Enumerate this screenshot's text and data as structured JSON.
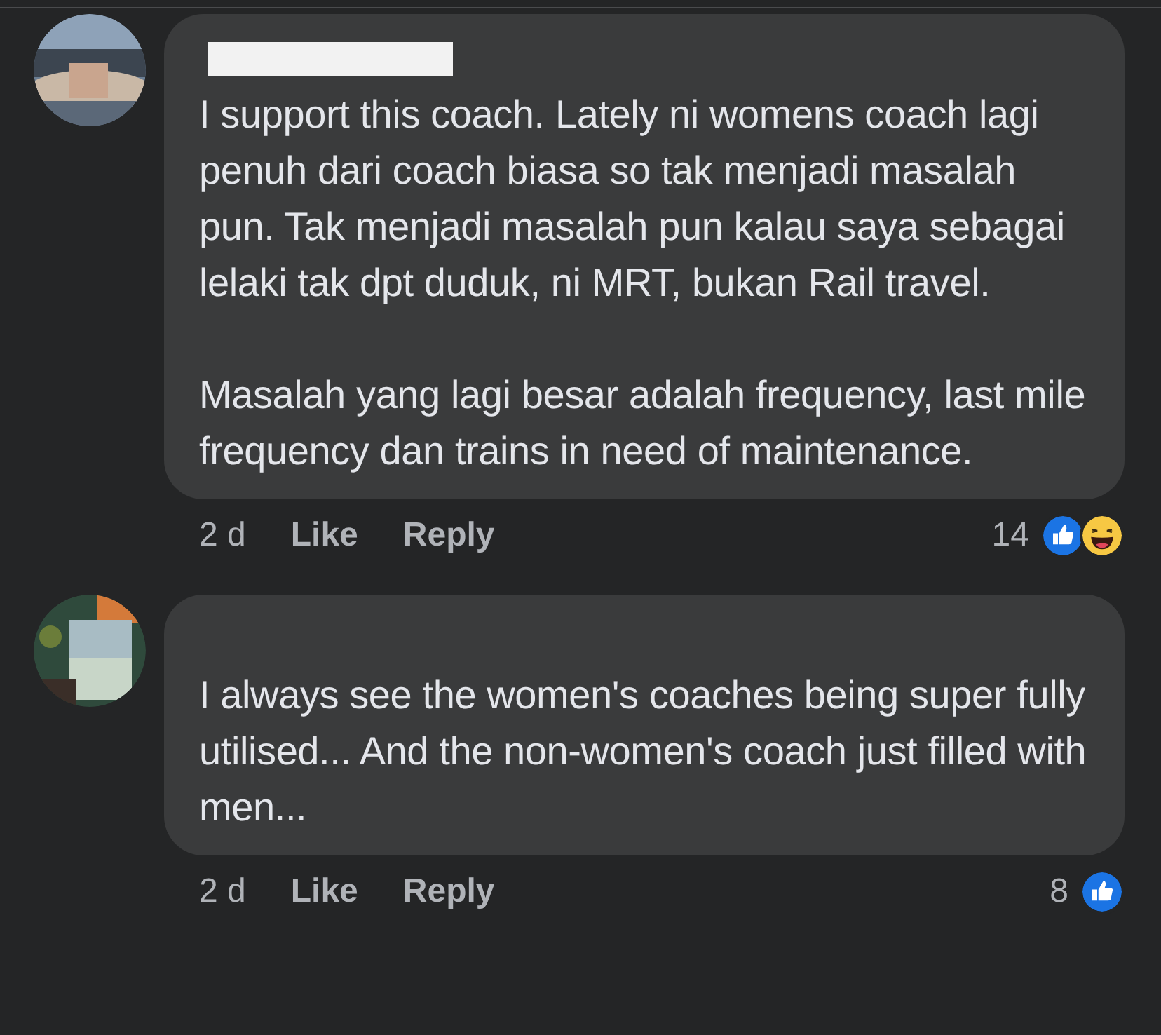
{
  "comments": [
    {
      "name_redacted": true,
      "paragraphs": [
        "I support this coach. Lately ni womens coach lagi penuh dari coach biasa so tak menjadi masalah pun. Tak menjadi masalah pun kalau saya sebagai lelaki tak dpt duduk, ni MRT, bukan Rail travel.",
        "Masalah yang lagi besar adalah frequency, last mile frequency dan trains in need of maintenance."
      ],
      "time": "2 d",
      "actions": [
        "Like",
        "Reply"
      ],
      "reaction_count": "14",
      "reactions": [
        {
          "kind": "like"
        },
        {
          "kind": "haha"
        }
      ]
    },
    {
      "name_redacted": false,
      "paragraphs": [
        "I always see the women's coaches being super fully utilised... And the non-women's coach just filled with men..."
      ],
      "time": "2 d",
      "actions": [
        "Like",
        "Reply"
      ],
      "reaction_count": "8",
      "reactions": [
        {
          "kind": "like"
        }
      ]
    }
  ]
}
